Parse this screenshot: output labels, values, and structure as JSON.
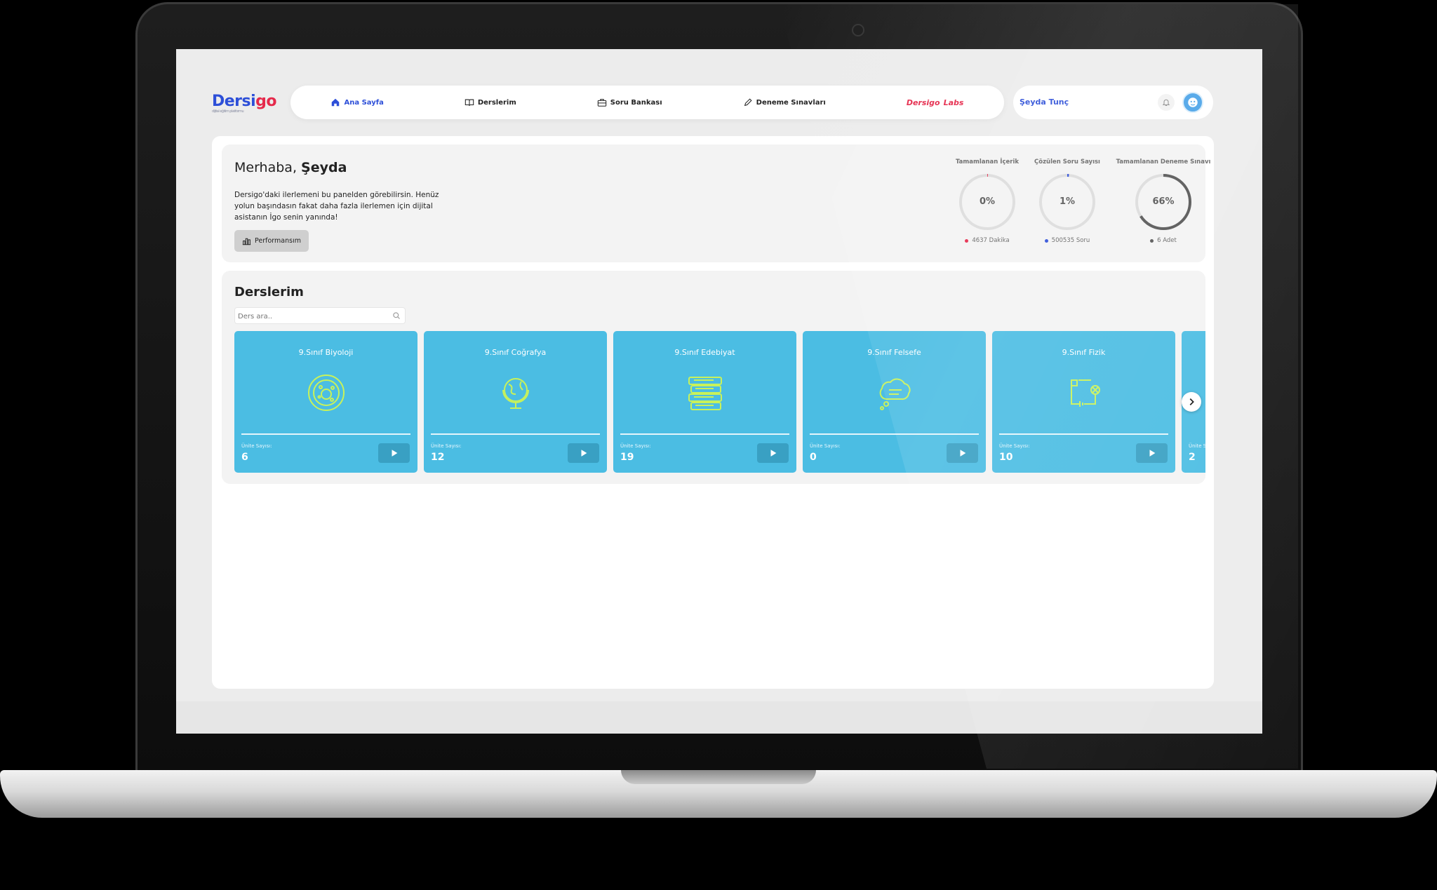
{
  "brand": {
    "name_main": "Dersi",
    "name_accent": "go",
    "tagline": "dijital eğitim platformu"
  },
  "nav": {
    "items": [
      {
        "label": "Ana Sayfa",
        "icon": "home-icon"
      },
      {
        "label": "Derslerim",
        "icon": "book-icon"
      },
      {
        "label": "Soru Bankası",
        "icon": "briefcase-icon"
      },
      {
        "label": "Deneme Sınavları",
        "icon": "pencil-icon"
      }
    ],
    "labs_main": "Dersigo",
    "labs_accent": "Labs"
  },
  "user": {
    "name": "Şeyda Tunç"
  },
  "welcome": {
    "greeting": "Merhaba,",
    "name": "Şeyda",
    "description": "Dersigo'daki ilerlemeni bu panelden görebilirsin. Henüz yolun başındasın fakat daha fazla ilerlemen için dijital asistanın İgo senin yanında!",
    "performance_button": "Performansım"
  },
  "stats": [
    {
      "title": "Tamamlanan İçerik",
      "value": "0%",
      "percent": 0,
      "sub": "4637 Dakika",
      "color": "#e5294b"
    },
    {
      "title": "Çözülen Soru Sayısı",
      "value": "1%",
      "percent": 1,
      "sub": "500535 Soru",
      "color": "#2d4fd8"
    },
    {
      "title": "Tamamlanan Deneme Sınavı",
      "value": "66%",
      "percent": 66,
      "sub": "6 Adet",
      "color": "#555555"
    }
  ],
  "courses": {
    "title": "Derslerim",
    "search_placeholder": "Ders ara..",
    "unit_label": "Ünite Sayısı:",
    "items": [
      {
        "name": "9.Sınıf Biyoloji",
        "units": "6",
        "icon": "cell-icon"
      },
      {
        "name": "9.Sınıf Coğrafya",
        "units": "12",
        "icon": "globe-icon"
      },
      {
        "name": "9.Sınıf Edebiyat",
        "units": "19",
        "icon": "books-icon"
      },
      {
        "name": "9.Sınıf Felsefe",
        "units": "0",
        "icon": "thought-bubble-icon"
      },
      {
        "name": "9.Sınıf Fizik",
        "units": "10",
        "icon": "circuit-icon"
      },
      {
        "name": "",
        "units": "2",
        "icon": ""
      }
    ]
  },
  "colors": {
    "brand_blue": "#2d4fd8",
    "brand_red": "#e5294b",
    "card_blue": "#4bbde3"
  }
}
